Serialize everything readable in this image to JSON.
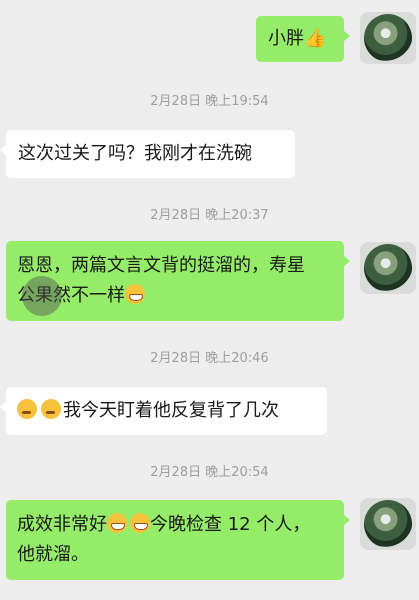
{
  "messages": [
    {
      "side": "out",
      "text": "小胖",
      "emoji": "thumbs-up"
    },
    {
      "time": "2月28日 晚上19:54"
    },
    {
      "side": "in",
      "text": "这次过关了吗？我刚才在洗碗"
    },
    {
      "time": "2月28日 晚上20:37"
    },
    {
      "side": "out",
      "line1": "恩恩，两篇文言文背的挺溜的，寿星",
      "line2": "公果然不一样"
    },
    {
      "time": "2月28日 晚上20:46"
    },
    {
      "side": "in",
      "text": "我今天盯着他反复背了几次"
    },
    {
      "time": "2月28日 晚上20:54"
    },
    {
      "side": "out",
      "line1_a": "成效非常好",
      "line1_b": "今晚检查 12 个人，",
      "line2": "他就溜。"
    }
  ],
  "icons": {
    "thumbs_up": "👍"
  },
  "colors": {
    "outgoing_bubble": "#95ec69",
    "incoming_bubble": "#ffffff",
    "background": "#ededed",
    "timestamp": "#9e9e9e"
  }
}
